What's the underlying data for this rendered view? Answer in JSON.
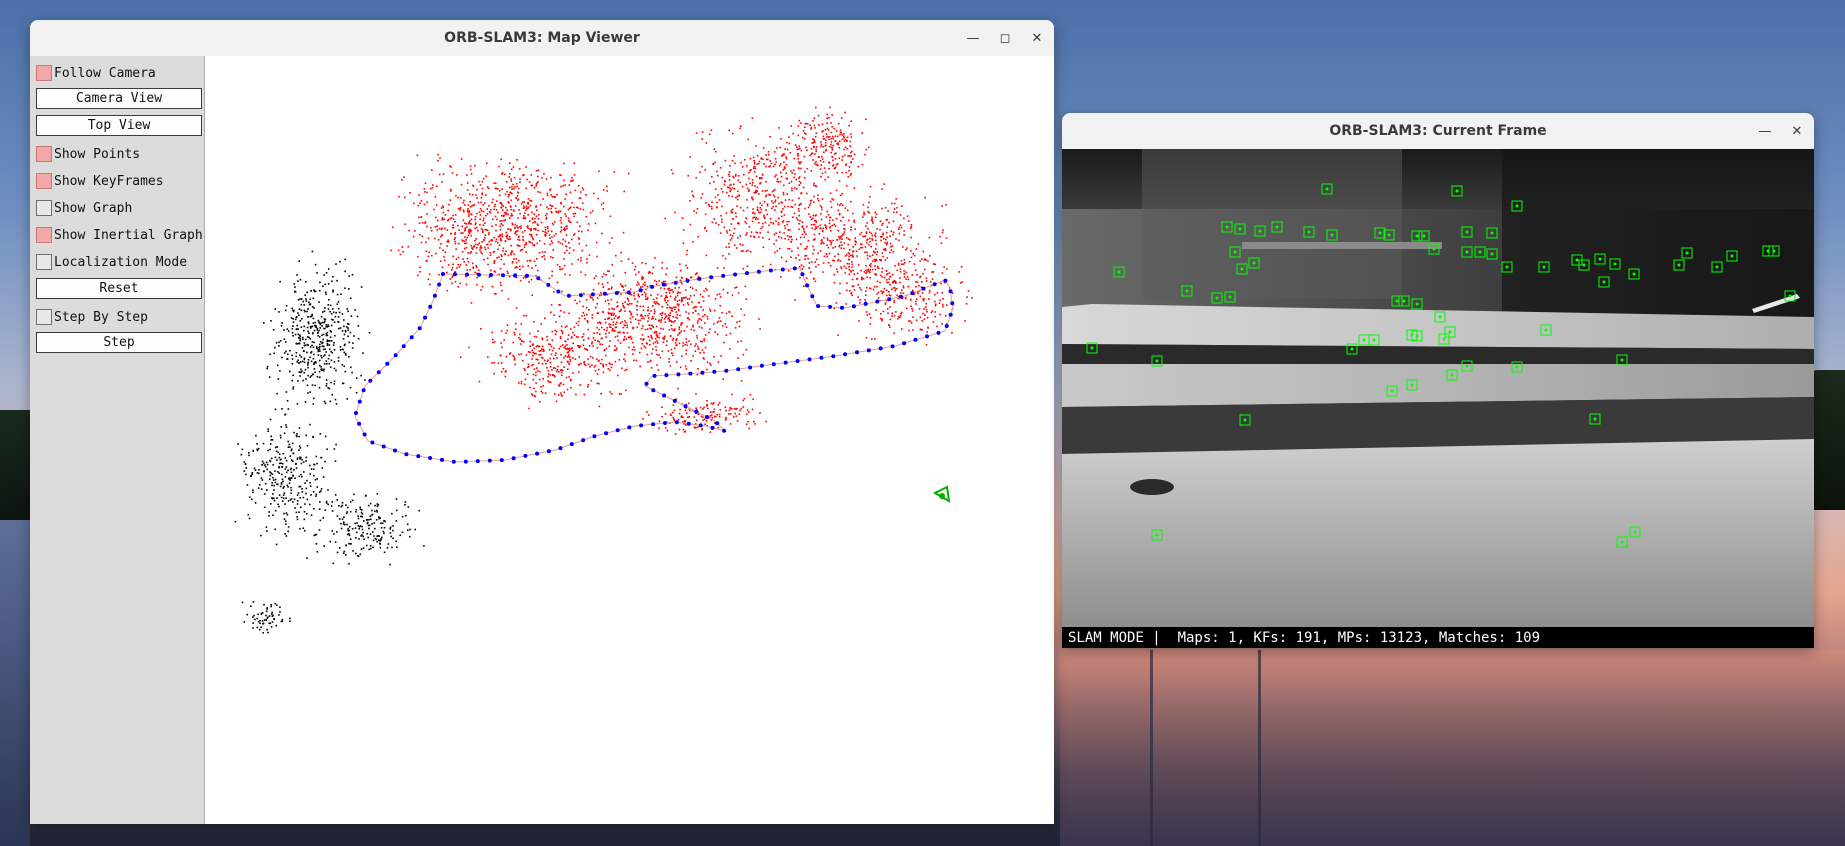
{
  "map_viewer": {
    "title": "ORB-SLAM3: Map Viewer",
    "controls": [
      {
        "type": "checkbox",
        "label": "Follow Camera",
        "checked": true
      },
      {
        "type": "button",
        "label": "Camera View"
      },
      {
        "type": "button",
        "label": "Top View"
      },
      {
        "type": "checkbox",
        "label": "Show Points",
        "checked": true
      },
      {
        "type": "checkbox",
        "label": "Show KeyFrames",
        "checked": true
      },
      {
        "type": "checkbox",
        "label": "Show Graph",
        "checked": false
      },
      {
        "type": "checkbox",
        "label": "Show Inertial Graph",
        "checked": true
      },
      {
        "type": "checkbox",
        "label": "Localization Mode",
        "checked": false
      },
      {
        "type": "button",
        "label": "Reset"
      },
      {
        "type": "checkbox",
        "label": "Step By Step",
        "checked": false
      },
      {
        "type": "button",
        "label": "Step"
      }
    ],
    "colors": {
      "map_point_active": "#ff0000",
      "map_point_inactive": "#000000",
      "keyframe": "#0000ff",
      "trajectory": "#e59a9a",
      "current_camera": "#00b000"
    }
  },
  "current_frame": {
    "title": "ORB-SLAM3: Current Frame",
    "status": "SLAM MODE |  Maps: 1, KFs: 191, MPs: 13123, Matches: 109",
    "feature_color": "#00ff00"
  },
  "window_controls": {
    "minimize": "minimize-icon",
    "maximize": "maximize-icon",
    "close": "close-icon"
  }
}
